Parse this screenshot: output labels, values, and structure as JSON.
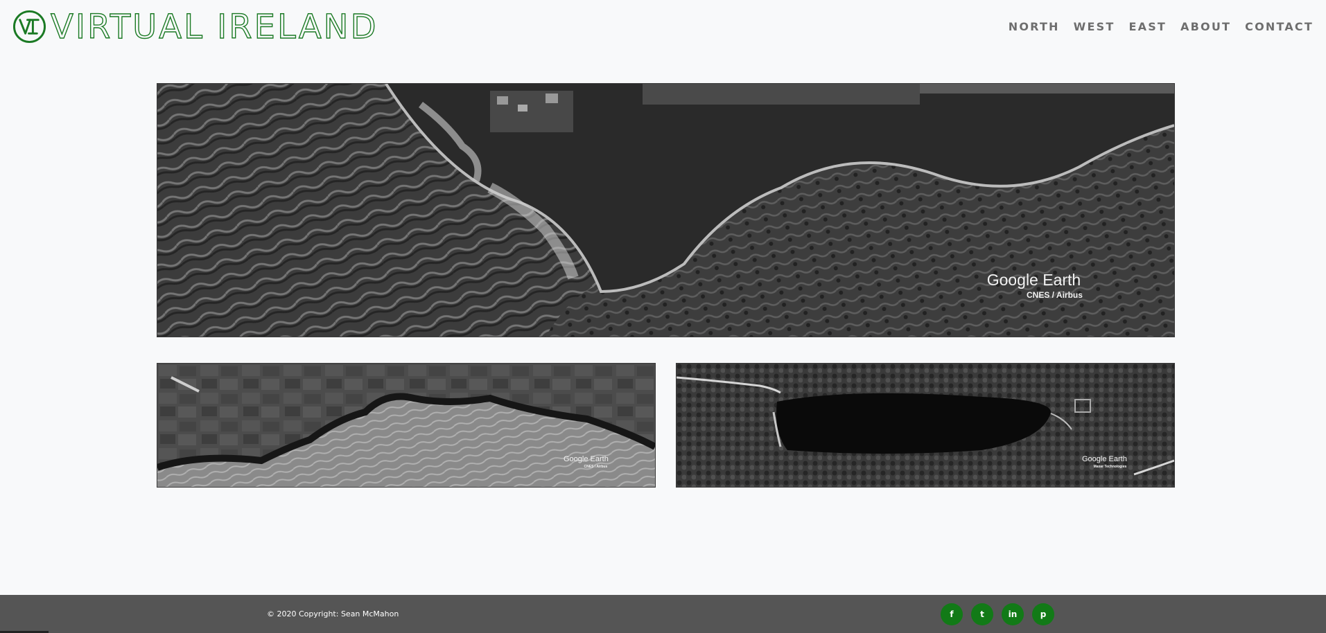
{
  "header": {
    "logo_monogram": "VI",
    "site_title": "VIRTUAL IRELAND",
    "brand_color": "#1b7a24",
    "nav": [
      {
        "label": "NORTH"
      },
      {
        "label": "WEST"
      },
      {
        "label": "EAST"
      },
      {
        "label": "ABOUT"
      },
      {
        "label": "CONTACT"
      }
    ]
  },
  "gallery": {
    "hero": {
      "watermark": "Google Earth",
      "credit": "CNES / Airbus"
    },
    "thumbnails": [
      {
        "watermark": "Google Earth",
        "credit": "CNES / Airbus"
      },
      {
        "watermark": "Google Earth",
        "credit": "Maxar Technologies"
      }
    ]
  },
  "footer": {
    "copyright": "© 2020 Copyright: Sean McMahon",
    "background_color": "#555555",
    "social_color": "#127a17",
    "socials": [
      {
        "icon": "facebook-icon",
        "glyph": "f"
      },
      {
        "icon": "twitter-icon",
        "glyph": "t"
      },
      {
        "icon": "linkedin-icon",
        "glyph": "in"
      },
      {
        "icon": "pinterest-icon",
        "glyph": "p"
      }
    ]
  }
}
